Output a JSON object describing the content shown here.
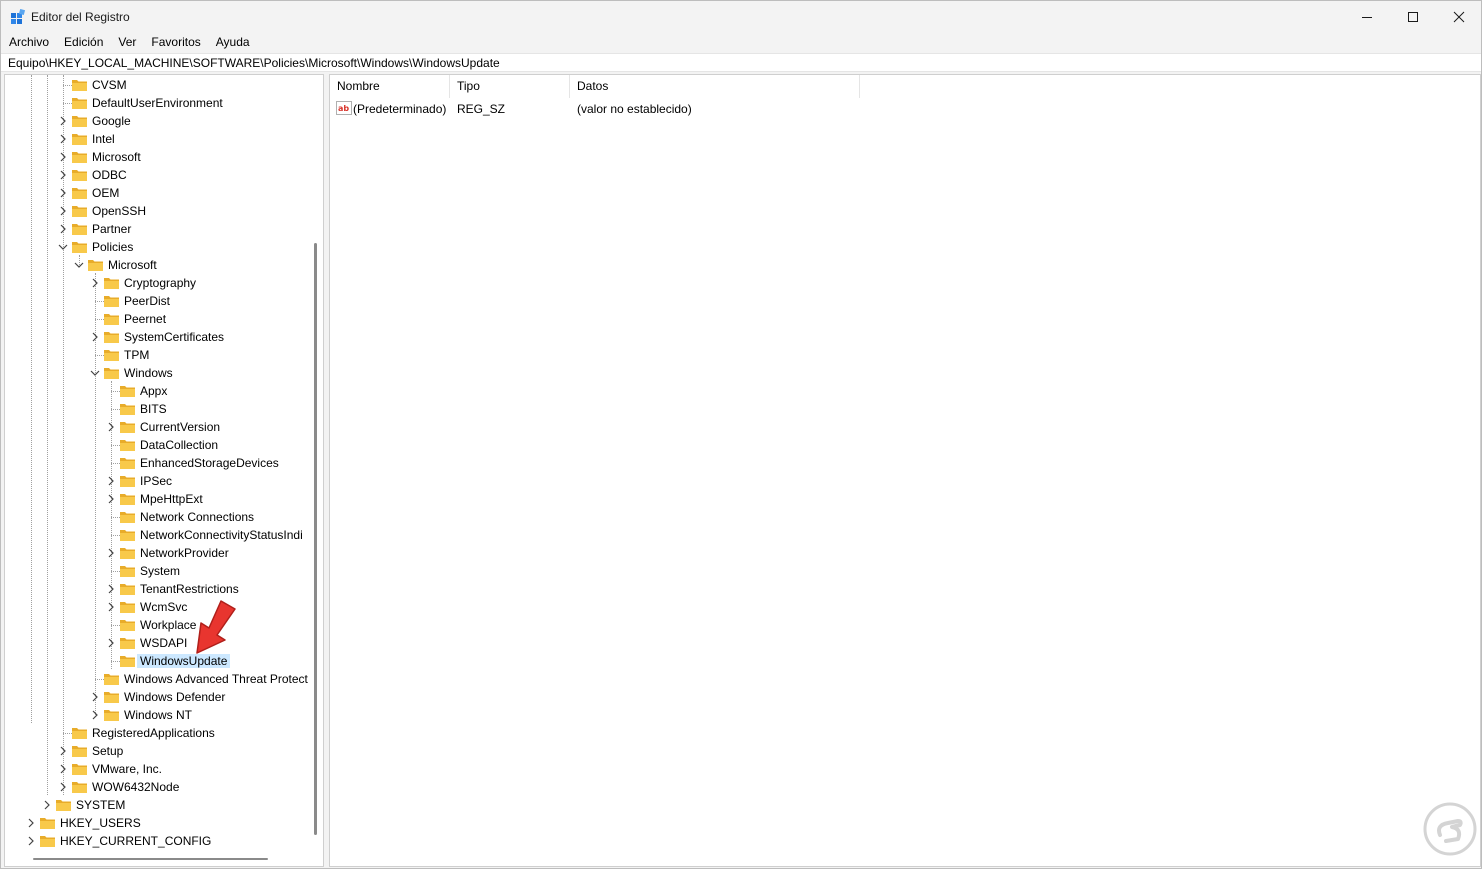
{
  "window": {
    "title": "Editor del Registro",
    "icon": "regedit-icon",
    "controls": [
      "minimize-icon",
      "maximize-icon",
      "close-icon"
    ]
  },
  "menu": [
    "Archivo",
    "Edición",
    "Ver",
    "Favoritos",
    "Ayuda"
  ],
  "address": "Equipo\\HKEY_LOCAL_MACHINE\\SOFTWARE\\Policies\\Microsoft\\Windows\\WindowsUpdate",
  "tree": [
    {
      "label": "CVSM",
      "level": 2,
      "expander": "none"
    },
    {
      "label": "DefaultUserEnvironment",
      "level": 2,
      "expander": "none"
    },
    {
      "label": "Google",
      "level": 2,
      "expander": "collapsed"
    },
    {
      "label": "Intel",
      "level": 2,
      "expander": "collapsed"
    },
    {
      "label": "Microsoft",
      "level": 2,
      "expander": "collapsed"
    },
    {
      "label": "ODBC",
      "level": 2,
      "expander": "collapsed"
    },
    {
      "label": "OEM",
      "level": 2,
      "expander": "collapsed"
    },
    {
      "label": "OpenSSH",
      "level": 2,
      "expander": "collapsed"
    },
    {
      "label": "Partner",
      "level": 2,
      "expander": "collapsed"
    },
    {
      "label": "Policies",
      "level": 2,
      "expander": "expanded"
    },
    {
      "label": "Microsoft",
      "level": 3,
      "expander": "expanded"
    },
    {
      "label": "Cryptography",
      "level": 4,
      "expander": "collapsed"
    },
    {
      "label": "PeerDist",
      "level": 4,
      "expander": "none"
    },
    {
      "label": "Peernet",
      "level": 4,
      "expander": "none"
    },
    {
      "label": "SystemCertificates",
      "level": 4,
      "expander": "collapsed"
    },
    {
      "label": "TPM",
      "level": 4,
      "expander": "none"
    },
    {
      "label": "Windows",
      "level": 4,
      "expander": "expanded"
    },
    {
      "label": "Appx",
      "level": 5,
      "expander": "none"
    },
    {
      "label": "BITS",
      "level": 5,
      "expander": "none"
    },
    {
      "label": "CurrentVersion",
      "level": 5,
      "expander": "collapsed"
    },
    {
      "label": "DataCollection",
      "level": 5,
      "expander": "none"
    },
    {
      "label": "EnhancedStorageDevices",
      "level": 5,
      "expander": "none"
    },
    {
      "label": "IPSec",
      "level": 5,
      "expander": "collapsed"
    },
    {
      "label": "MpeHttpExt",
      "level": 5,
      "expander": "collapsed"
    },
    {
      "label": "Network Connections",
      "level": 5,
      "expander": "none"
    },
    {
      "label": "NetworkConnectivityStatusIndi",
      "level": 5,
      "expander": "none"
    },
    {
      "label": "NetworkProvider",
      "level": 5,
      "expander": "collapsed"
    },
    {
      "label": "System",
      "level": 5,
      "expander": "none"
    },
    {
      "label": "TenantRestrictions",
      "level": 5,
      "expander": "collapsed"
    },
    {
      "label": "WcmSvc",
      "level": 5,
      "expander": "collapsed"
    },
    {
      "label": "Workplace",
      "level": 5,
      "expander": "none"
    },
    {
      "label": "WSDAPI",
      "level": 5,
      "expander": "collapsed"
    },
    {
      "label": "WindowsUpdate",
      "level": 5,
      "expander": "none",
      "selected": true
    },
    {
      "label": "Windows Advanced Threat Protect",
      "level": 4,
      "expander": "none"
    },
    {
      "label": "Windows Defender",
      "level": 4,
      "expander": "collapsed"
    },
    {
      "label": "Windows NT",
      "level": 4,
      "expander": "collapsed"
    },
    {
      "label": "RegisteredApplications",
      "level": 2,
      "expander": "none"
    },
    {
      "label": "Setup",
      "level": 2,
      "expander": "collapsed"
    },
    {
      "label": "VMware, Inc.",
      "level": 2,
      "expander": "collapsed"
    },
    {
      "label": "WOW6432Node",
      "level": 2,
      "expander": "collapsed"
    },
    {
      "label": "SYSTEM",
      "level": 1,
      "expander": "collapsed"
    },
    {
      "label": "HKEY_USERS",
      "level": 0,
      "expander": "collapsed"
    },
    {
      "label": "HKEY_CURRENT_CONFIG",
      "level": 0,
      "expander": "collapsed"
    }
  ],
  "list": {
    "columns": [
      "Nombre",
      "Tipo",
      "Datos"
    ],
    "rows": [
      {
        "icon": "string-value-icon",
        "name": "(Predeterminado)",
        "type": "REG_SZ",
        "data": "(valor no establecido)"
      }
    ]
  },
  "colors": {
    "selection": "#cce8ff",
    "folder": "#f8c94a",
    "arrow": "#e8352f"
  }
}
